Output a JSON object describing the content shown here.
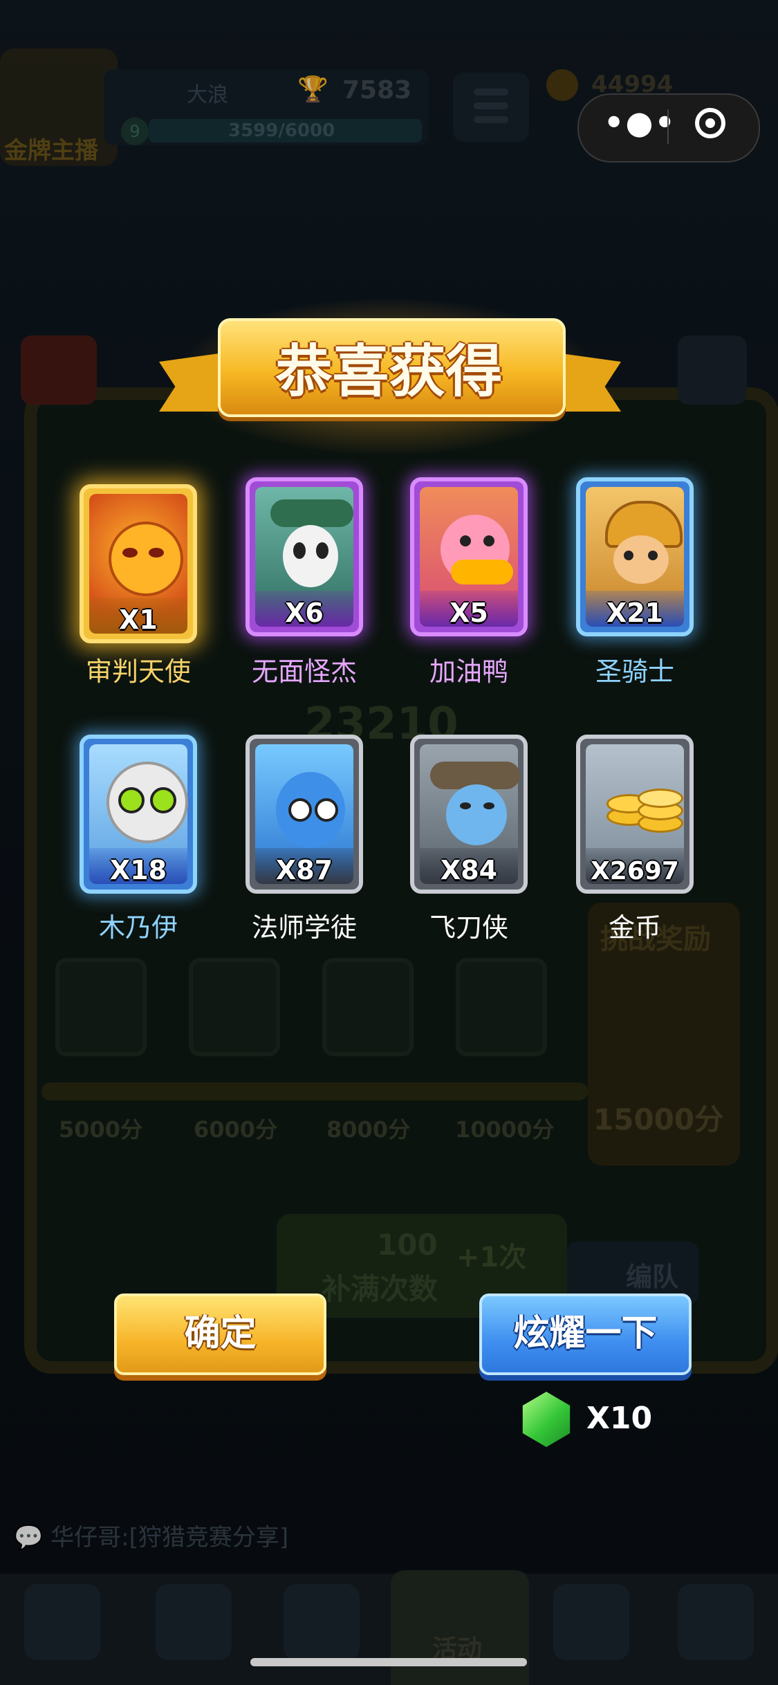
{
  "background": {
    "player_badge": "金牌主播",
    "player_name": "大浪",
    "trophies": "7583",
    "level": "9",
    "xp": "3599/6000",
    "coins": "44994",
    "center_score": "23210",
    "reward_title": "挑战奖励",
    "milestones": [
      "5000分",
      "6000分",
      "8000分",
      "10000分"
    ],
    "final_milestone": "15000分",
    "refill_cost": "100",
    "refill_label": "补满次数",
    "plus_label": "+1次",
    "team_button": "编队",
    "chat_message": "华仔哥:[狩猎竞赛分享]",
    "nav_active_label": "活动"
  },
  "capsule": {
    "more_icon": "more-dots-icon",
    "close_icon": "target-close-icon"
  },
  "popup": {
    "title": "恭喜获得",
    "rewards": [
      {
        "name": "审判天使",
        "count": "X1",
        "rarity": "legendary",
        "name_color": "#f7d36a"
      },
      {
        "name": "无面怪杰",
        "count": "X6",
        "rarity": "epic",
        "name_color": "#e6a7ff"
      },
      {
        "name": "加油鸭",
        "count": "X5",
        "rarity": "epic",
        "name_color": "#e6a7ff"
      },
      {
        "name": "圣骑士",
        "count": "X21",
        "rarity": "rare",
        "name_color": "#8fd3ff"
      },
      {
        "name": "木乃伊",
        "count": "X18",
        "rarity": "rare",
        "name_color": "#8fd3ff"
      },
      {
        "name": "法师学徒",
        "count": "X87",
        "rarity": "common",
        "name_color": "#ffffff"
      },
      {
        "name": "飞刀侠",
        "count": "X84",
        "rarity": "common",
        "name_color": "#ffffff"
      },
      {
        "name": "金币",
        "count": "X2697",
        "rarity": "common",
        "name_color": "#ffffff"
      }
    ],
    "confirm_label": "确定",
    "share_label": "炫耀一下",
    "share_cost": "X10"
  }
}
